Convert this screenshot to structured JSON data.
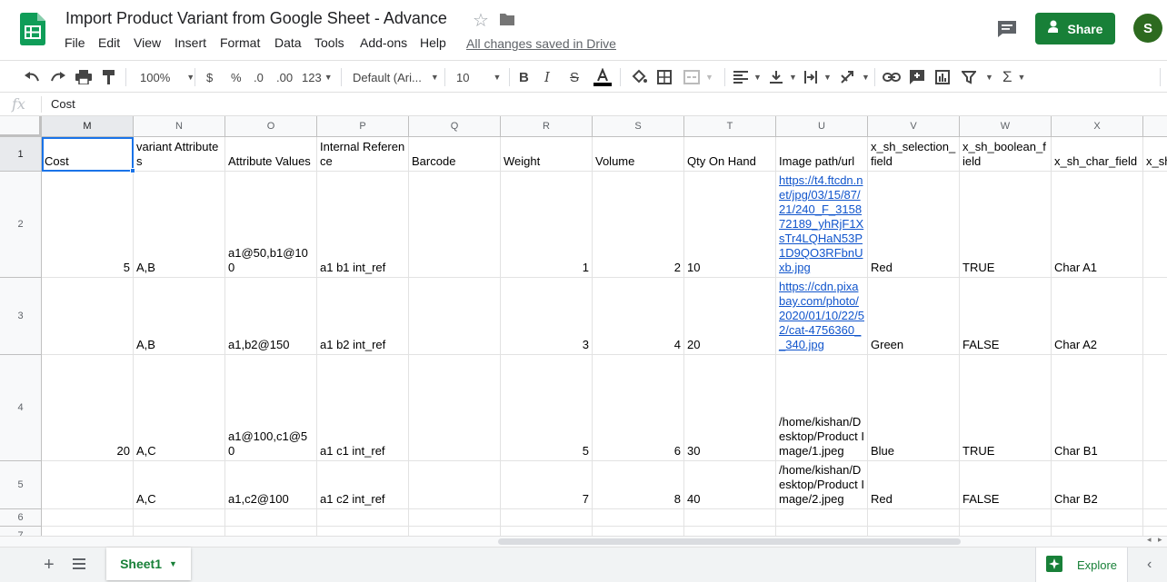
{
  "document": {
    "title": "Import Product Variant from Google Sheet - Advance",
    "saved_status": "All changes saved in Drive"
  },
  "menu": [
    "File",
    "Edit",
    "View",
    "Insert",
    "Format",
    "Data",
    "Tools",
    "Add-ons",
    "Help"
  ],
  "header": {
    "share_label": "Share",
    "avatar_initial": "S"
  },
  "toolbar": {
    "zoom": "100%",
    "currency": "$",
    "percent": "%",
    "decimal_decrease": ".0",
    "decimal_increase": ".00",
    "more_formats": "123",
    "font": "Default (Ari...",
    "font_size": "10"
  },
  "formula_bar": {
    "fx": "fx",
    "value": "Cost"
  },
  "grid": {
    "columns": [
      "M",
      "N",
      "O",
      "P",
      "Q",
      "R",
      "S",
      "T",
      "U",
      "V",
      "W",
      "X"
    ],
    "rows": [
      "1",
      "2",
      "3",
      "4",
      "5",
      "6",
      "7"
    ],
    "selected_cell": "M1",
    "headers": [
      "Cost",
      "variant Attributes",
      "Attribute Values",
      "Internal Reference",
      "Barcode",
      "Weight",
      "Volume",
      "Qty On Hand",
      "Image path/url",
      "x_sh_selection_field",
      "x_sh_boolean_field",
      "x_sh_char_field",
      "x_sh"
    ],
    "data": [
      [
        "5",
        "A,B",
        "a1@50,b1@100",
        "a1 b1 int_ref",
        "",
        "1",
        "2",
        "10",
        "https://t4.ftcdn.net/jpg/03/15/87/21/240_F_315872189_yhRjF1XsTr4LQHaN53P1D9QO3RFbnUxb.jpg",
        "Red",
        "TRUE",
        "Char A1"
      ],
      [
        "",
        "A,B",
        "a1,b2@150",
        "a1 b2 int_ref",
        "",
        "3",
        "4",
        "20",
        "https://cdn.pixabay.com/photo/2020/01/10/22/52/cat-4756360__340.jpg",
        "Green",
        "FALSE",
        "Char A2"
      ],
      [
        "20",
        "A,C",
        "a1@100,c1@50",
        "a1 c1 int_ref",
        "",
        "5",
        "6",
        "30",
        "/home/kishan/Desktop/Product Image/1.jpeg",
        "Blue",
        "TRUE",
        "Char B1"
      ],
      [
        "",
        "A,C",
        "a1,c2@100",
        "a1 c2 int_ref",
        "",
        "7",
        "8",
        "40",
        "/home/kishan/Desktop/Product Image/2.jpeg",
        "Red",
        "FALSE",
        "Char B2"
      ]
    ]
  },
  "sheets": {
    "active": "Sheet1"
  },
  "explore_label": "Explore",
  "colors": {
    "brand_green": "#188038",
    "link": "#1155cc",
    "selection": "#1a73e8"
  }
}
